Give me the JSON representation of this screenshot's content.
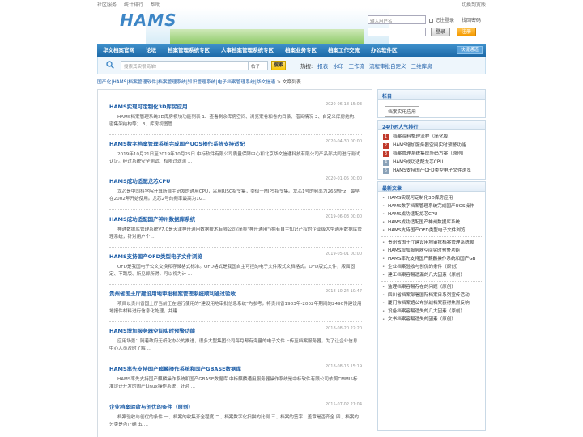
{
  "top": {
    "links": [
      "社区服务",
      "统计排行",
      "帮助"
    ],
    "right": "切换到宽版"
  },
  "header": {
    "logo": "HAMS"
  },
  "login": {
    "user_placeholder": "输入用户名",
    "remember": "记住登录",
    "find_pwd": "找回密码",
    "login_btn": "登录",
    "register_btn": "注册"
  },
  "nav": {
    "items": [
      "华文档案官网",
      "论坛",
      "档案管理系统专区",
      "人事档案管理系统专区",
      "档案业务专区",
      "档案工作交流",
      "办公软件区"
    ],
    "quick": "快捷通道"
  },
  "search": {
    "placeholder": "搜索其实很简单!",
    "type": "帖子",
    "button": "搜索",
    "hot_label": "热搜:",
    "hot": [
      "报表",
      "水印",
      "工作流",
      "流程审批自定义",
      "三维库房"
    ]
  },
  "breadcrumb": {
    "path": "国产化|HAMS|档案管理软件|档案管理系统|知识管理系统|电子档案管理系统|华文信通",
    "sep": " > ",
    "current": "文章列表"
  },
  "articles": [
    {
      "title": "HAMS实现可定制化3D库房应用",
      "date": "2020-06-18 15:03",
      "summary": "HAMS档案管理系统3D库房模块功能列表 1、查看剩余库房空间、浏览案卷和卷内目录、借阅情况 2、自定义库房结构、密集架结构等； 3、库房视图管..."
    },
    {
      "title": "HAMS数字档案管理系统完成国产UOS操作系统支持适配",
      "date": "2020-04-30 00:00",
      "summary": "2019年10月21日至2019年10月25日 中标软件有限公司质量保障中心和北京华文信通科技有限公司产品部共同进行测试认证。经过系统安全测试、权限过滤测 ..."
    },
    {
      "title": "HAMS成功适配龙芯CPU",
      "date": "2020-01-05 00:00",
      "summary": "龙芯是中国科学院计算所自主研发的通用CPU，采用RISC指令集，类似于MIPS指令集。龙芯1号的频率为266MHz，最早在2002年开始使用。龙芯2号的频率最高为1G..."
    },
    {
      "title": "HAMS成功适配国产神州数据库系统",
      "date": "2019-06-03 00:00",
      "summary": "神通数据库管理系统V7.0是天津神舟通用数据技术有限公司(简称\"神舟通用\")拥有自主知识产权的企业级大型通用数据库管理系统，针对用户个 ..."
    },
    {
      "title": "HAMS支持国产OFD类型电子文件浏览",
      "date": "2019-05-01 00:00",
      "summary": "OFD是我国电子公文交换和存储格式标准。OFD格式是我国自主可控的电子文件版式文档格式。OFD版式文件，版面固定、不跑版、所见即所得，可以视为计 ..."
    },
    {
      "title": "贵州省国土厅建设用地审批档案管理系统顺利通过验收",
      "date": "2018-10-24 10:47",
      "summary": "项目以贵州省国土厅当前正在运行使用的\"建设用地审批信息系统\"为参考，将贵州省1983年-2002年期间的2490件建设用地报件材料进行信息化处理，并建 ..."
    },
    {
      "title": "HAMS增加服务器空间实时预警功能",
      "date": "2018-08-20 22:20",
      "summary": "应用场景：随着政府无纸化办公的推进，很多大型集团公司每月都有海量的电子文件上传至档案服务器，为了让企业信息中心人员及时了解 ..."
    },
    {
      "title": "HAMS率先支持国产麒麟操作系统和国产GBASE数据库",
      "date": "2018-08-16 15:19",
      "summary": "HAMS率先支持国产麒麟操作系统和国产GBASE数据库 中标麒麟通用服务器操作系统是中标软件有限公司依照CMMI5标准设计开发的国产Linux操作系统，针对 ..."
    },
    {
      "title": "企业档案验收与创优的条件（原创）",
      "date": "2015-07-02 21:04",
      "summary": "档案验收与创优的条件 一、档案的收集齐全程度 二、档案数字化扫描的比例 三、档案的签字、盖章是否齐全 四、档案的分类是否正确 五 ..."
    }
  ],
  "sidebar": {
    "column_title": "栏目",
    "column_label": "档案实用应用",
    "rank_title": "24小时人气排行",
    "rank": [
      {
        "n": "1",
        "text": "档案资料整理流程（简化版）"
      },
      {
        "n": "2",
        "text": "HAMS增加服务器空间实时预警功能"
      },
      {
        "n": "3",
        "text": "档案管理系统集成条码方案（原创）"
      },
      {
        "n": "4",
        "text": "HAMS成功适配龙芯CPU"
      },
      {
        "n": "5",
        "text": "HAMS支持国产OFD类型电子文件浏览"
      }
    ],
    "latest_title": "最新文章",
    "latest_a": [
      "HAMS实现可定制化3D库房应用",
      "HAMS数字档案管理系统完成国产UOS操作",
      "HAMS成功适配龙芯CPU",
      "HAMS成功适配国产神州数据库系统",
      "HAMS支持国产OFD类型电子文件浏览"
    ],
    "latest_b": [
      "贵州省国土厅建设用地审批档案管理系统顺",
      "HAMS增加服务器空间实时预警功能",
      "HAMS率先支持国产麒麟操作系统和国产GB",
      "企业档案验收与创优的条件（原创）",
      "建工档案容易遗漏的几大因素（原创）"
    ],
    "latest_c": [
      "监理档案容易存在的问题（原创）",
      "四川省档案部署国际档案日系列宣传活动",
      "厦门市档案馆公布抗战档案获得热烈反响",
      "设备档案容易遗失的几大因素（原创）",
      "文书档案容易遗失的因素（原创）"
    ]
  }
}
